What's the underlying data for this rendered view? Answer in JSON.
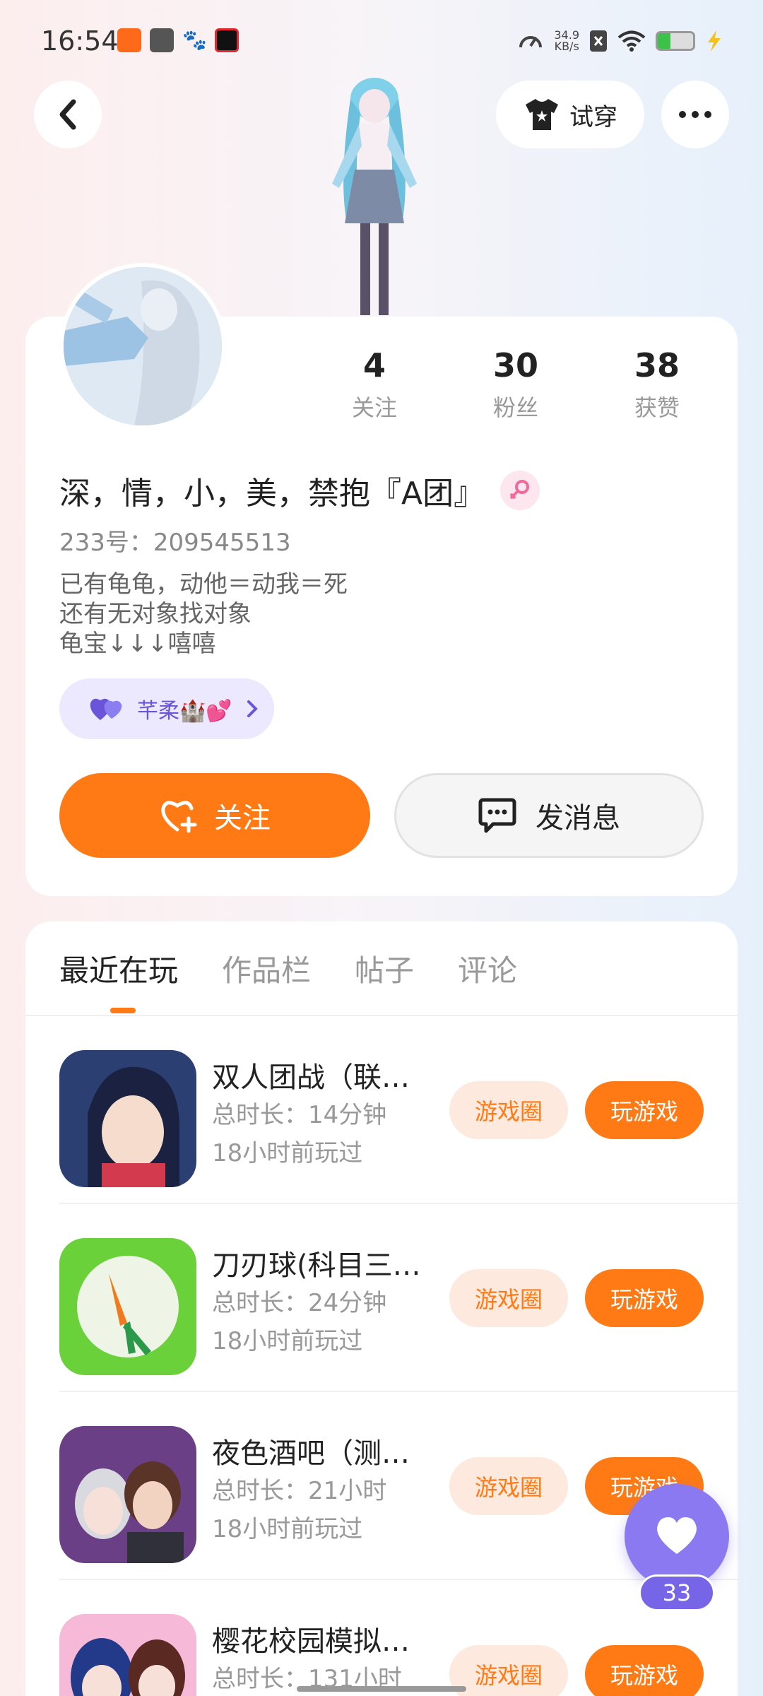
{
  "status_bar": {
    "time": "16:54",
    "net_speed_value": "34.9",
    "net_speed_unit": "KB/s",
    "battery_level": 0.35,
    "colors": {
      "battery_fill": "#3cc24a"
    }
  },
  "header": {
    "try_on_label": "试穿"
  },
  "profile": {
    "stats": [
      {
        "num": "4",
        "label": "关注"
      },
      {
        "num": "30",
        "label": "粉丝"
      },
      {
        "num": "38",
        "label": "获赞"
      }
    ],
    "nickname": "深，情，小，美，禁抱『A团』",
    "uid": "233号：209545513",
    "bio": [
      "已有龟龟，动他＝动我＝死",
      "还有无对象找对象",
      "龟宝↓↓↓嘻嘻"
    ],
    "cp_chip_label": "芊柔🏰💕",
    "follow_label": "关注",
    "message_label": "发消息"
  },
  "tabs": [
    "最近在玩",
    "作品栏",
    "帖子",
    "评论"
  ],
  "games": [
    {
      "title": "双人团战（联…",
      "duration": "总时长：14分钟",
      "last_played": "18小时前玩过",
      "circle_label": "游戏圈",
      "play_label": "玩游戏"
    },
    {
      "title": "刀刃球(科目三…",
      "duration": "总时长：24分钟",
      "last_played": "18小时前玩过",
      "circle_label": "游戏圈",
      "play_label": "玩游戏"
    },
    {
      "title": "夜色酒吧（测…",
      "duration": "总时长：21小时",
      "last_played": "18小时前玩过",
      "circle_label": "游戏圈",
      "play_label": "玩游戏"
    },
    {
      "title": "樱花校园模拟…",
      "duration": "总时长：131小时",
      "last_played": "",
      "circle_label": "游戏圈",
      "play_label": "玩游戏"
    }
  ],
  "like_fab": {
    "count": "33"
  },
  "colors": {
    "accent": "#ff7a14",
    "accent_light": "#fde9de",
    "purple": "#8a79f1"
  }
}
